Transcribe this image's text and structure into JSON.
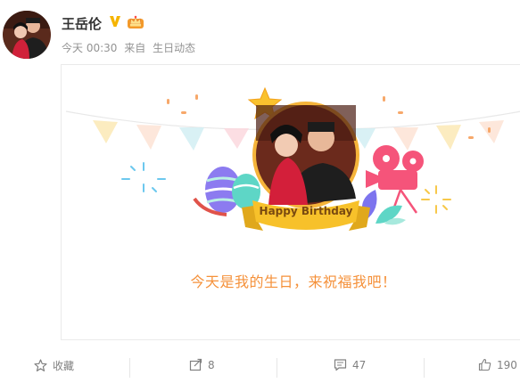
{
  "post": {
    "author": "王岳伦",
    "time": "今天 00:30",
    "source_prefix": "来自",
    "source": "生日动态",
    "card": {
      "banner_text": "Happy Birthday",
      "message": "今天是我的生日，来祝福我吧！"
    }
  },
  "actions": {
    "favorite_label": "收藏",
    "repost_count": "8",
    "comment_count": "47",
    "like_count": "190"
  },
  "colors": {
    "accent_orange": "#f5913a",
    "verified_gold": "#f5b400",
    "ribbon_gold": "#f7c12a",
    "muted_text": "#939393"
  },
  "icons": [
    "star-outline-icon",
    "repost-icon",
    "comment-icon",
    "thumbs-up-icon",
    "verified-v-icon",
    "crown-badge-icon"
  ]
}
